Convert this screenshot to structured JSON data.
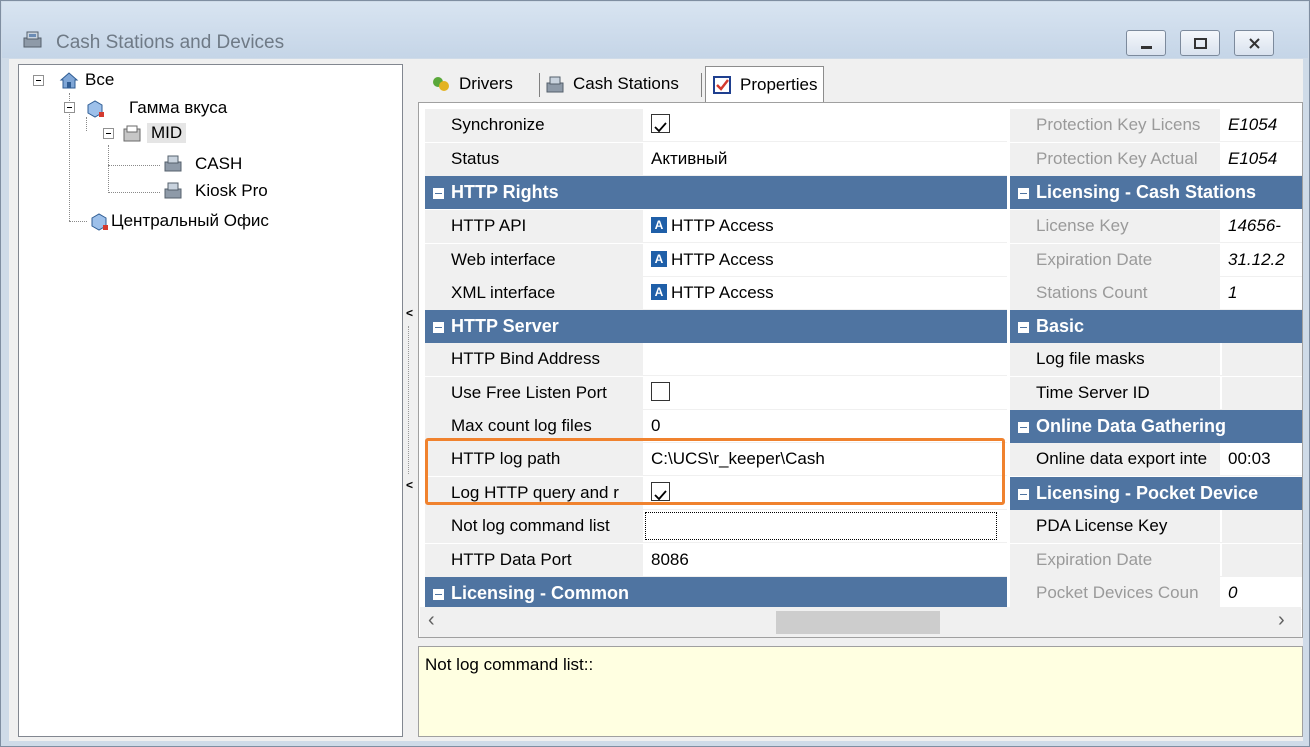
{
  "window": {
    "title": "Cash Stations and Devices"
  },
  "tree": [
    {
      "label": "Все"
    },
    {
      "label": "Гамма вкуса"
    },
    {
      "label": "MID"
    },
    {
      "label": "CASH"
    },
    {
      "label": "Kiosk Pro"
    },
    {
      "label": "Центральный Офис"
    }
  ],
  "tabs": [
    {
      "label": "Drivers"
    },
    {
      "label": "Cash Stations"
    },
    {
      "label": "Properties"
    }
  ],
  "left_grid": {
    "synchronize": {
      "name": "Synchronize",
      "checked": true
    },
    "status": {
      "name": "Status",
      "value": "Активный"
    },
    "http_rights": "HTTP Rights",
    "http_api": {
      "name": "HTTP API",
      "value": "HTTP Access"
    },
    "web_interface": {
      "name": "Web interface",
      "value": "HTTP Access"
    },
    "xml_interface": {
      "name": "XML interface",
      "value": "HTTP Access"
    },
    "http_server": "HTTP Server",
    "http_bind_address": {
      "name": "HTTP Bind Address",
      "value": ""
    },
    "use_free_listen_port": {
      "name": "Use Free Listen Port",
      "checked": false
    },
    "max_count_log_files": {
      "name": "Max count log files",
      "value": "0"
    },
    "http_log_path": {
      "name": "HTTP log path",
      "value": "C:\\UCS\\r_keeper\\Cash"
    },
    "log_http_query": {
      "name": "Log HTTP query and r",
      "checked": true
    },
    "not_log_command_list": {
      "name": "Not log command list",
      "value": ""
    },
    "http_data_port": {
      "name": "HTTP Data Port",
      "value": "8086"
    },
    "licensing_common": "Licensing - Common"
  },
  "right_grid": {
    "protection_key_license": {
      "name": "Protection Key Licens",
      "value": "E1054"
    },
    "protection_key_actual": {
      "name": "Protection Key Actual",
      "value": "E1054"
    },
    "licensing_cash_stations": "Licensing - Cash Stations",
    "license_key": {
      "name": "License Key",
      "value": "14656-"
    },
    "expiration_date": {
      "name": "Expiration Date",
      "value": "31.12.2"
    },
    "stations_count": {
      "name": "Stations Count",
      "value": "1"
    },
    "basic": "Basic",
    "log_file_masks": {
      "name": "Log file masks",
      "value": ""
    },
    "time_server_id": {
      "name": "Time Server ID",
      "value": ""
    },
    "online_data_gathering": "Online Data Gathering",
    "online_data_export": {
      "name": "Online data export inte",
      "value": "00:03"
    },
    "licensing_pocket_devices": "Licensing - Pocket Device",
    "pda_license_key": {
      "name": "PDA License Key",
      "value": ""
    },
    "pda_expiration_date": {
      "name": "Expiration Date",
      "value": ""
    },
    "pocket_devices_count": {
      "name": "Pocket Devices Coun",
      "value": "0"
    }
  },
  "description": {
    "text": "Not log command list::"
  },
  "colors": {
    "category": "#4f74a1",
    "highlight": "#f0822e",
    "description_bg": "#ffffe1"
  }
}
